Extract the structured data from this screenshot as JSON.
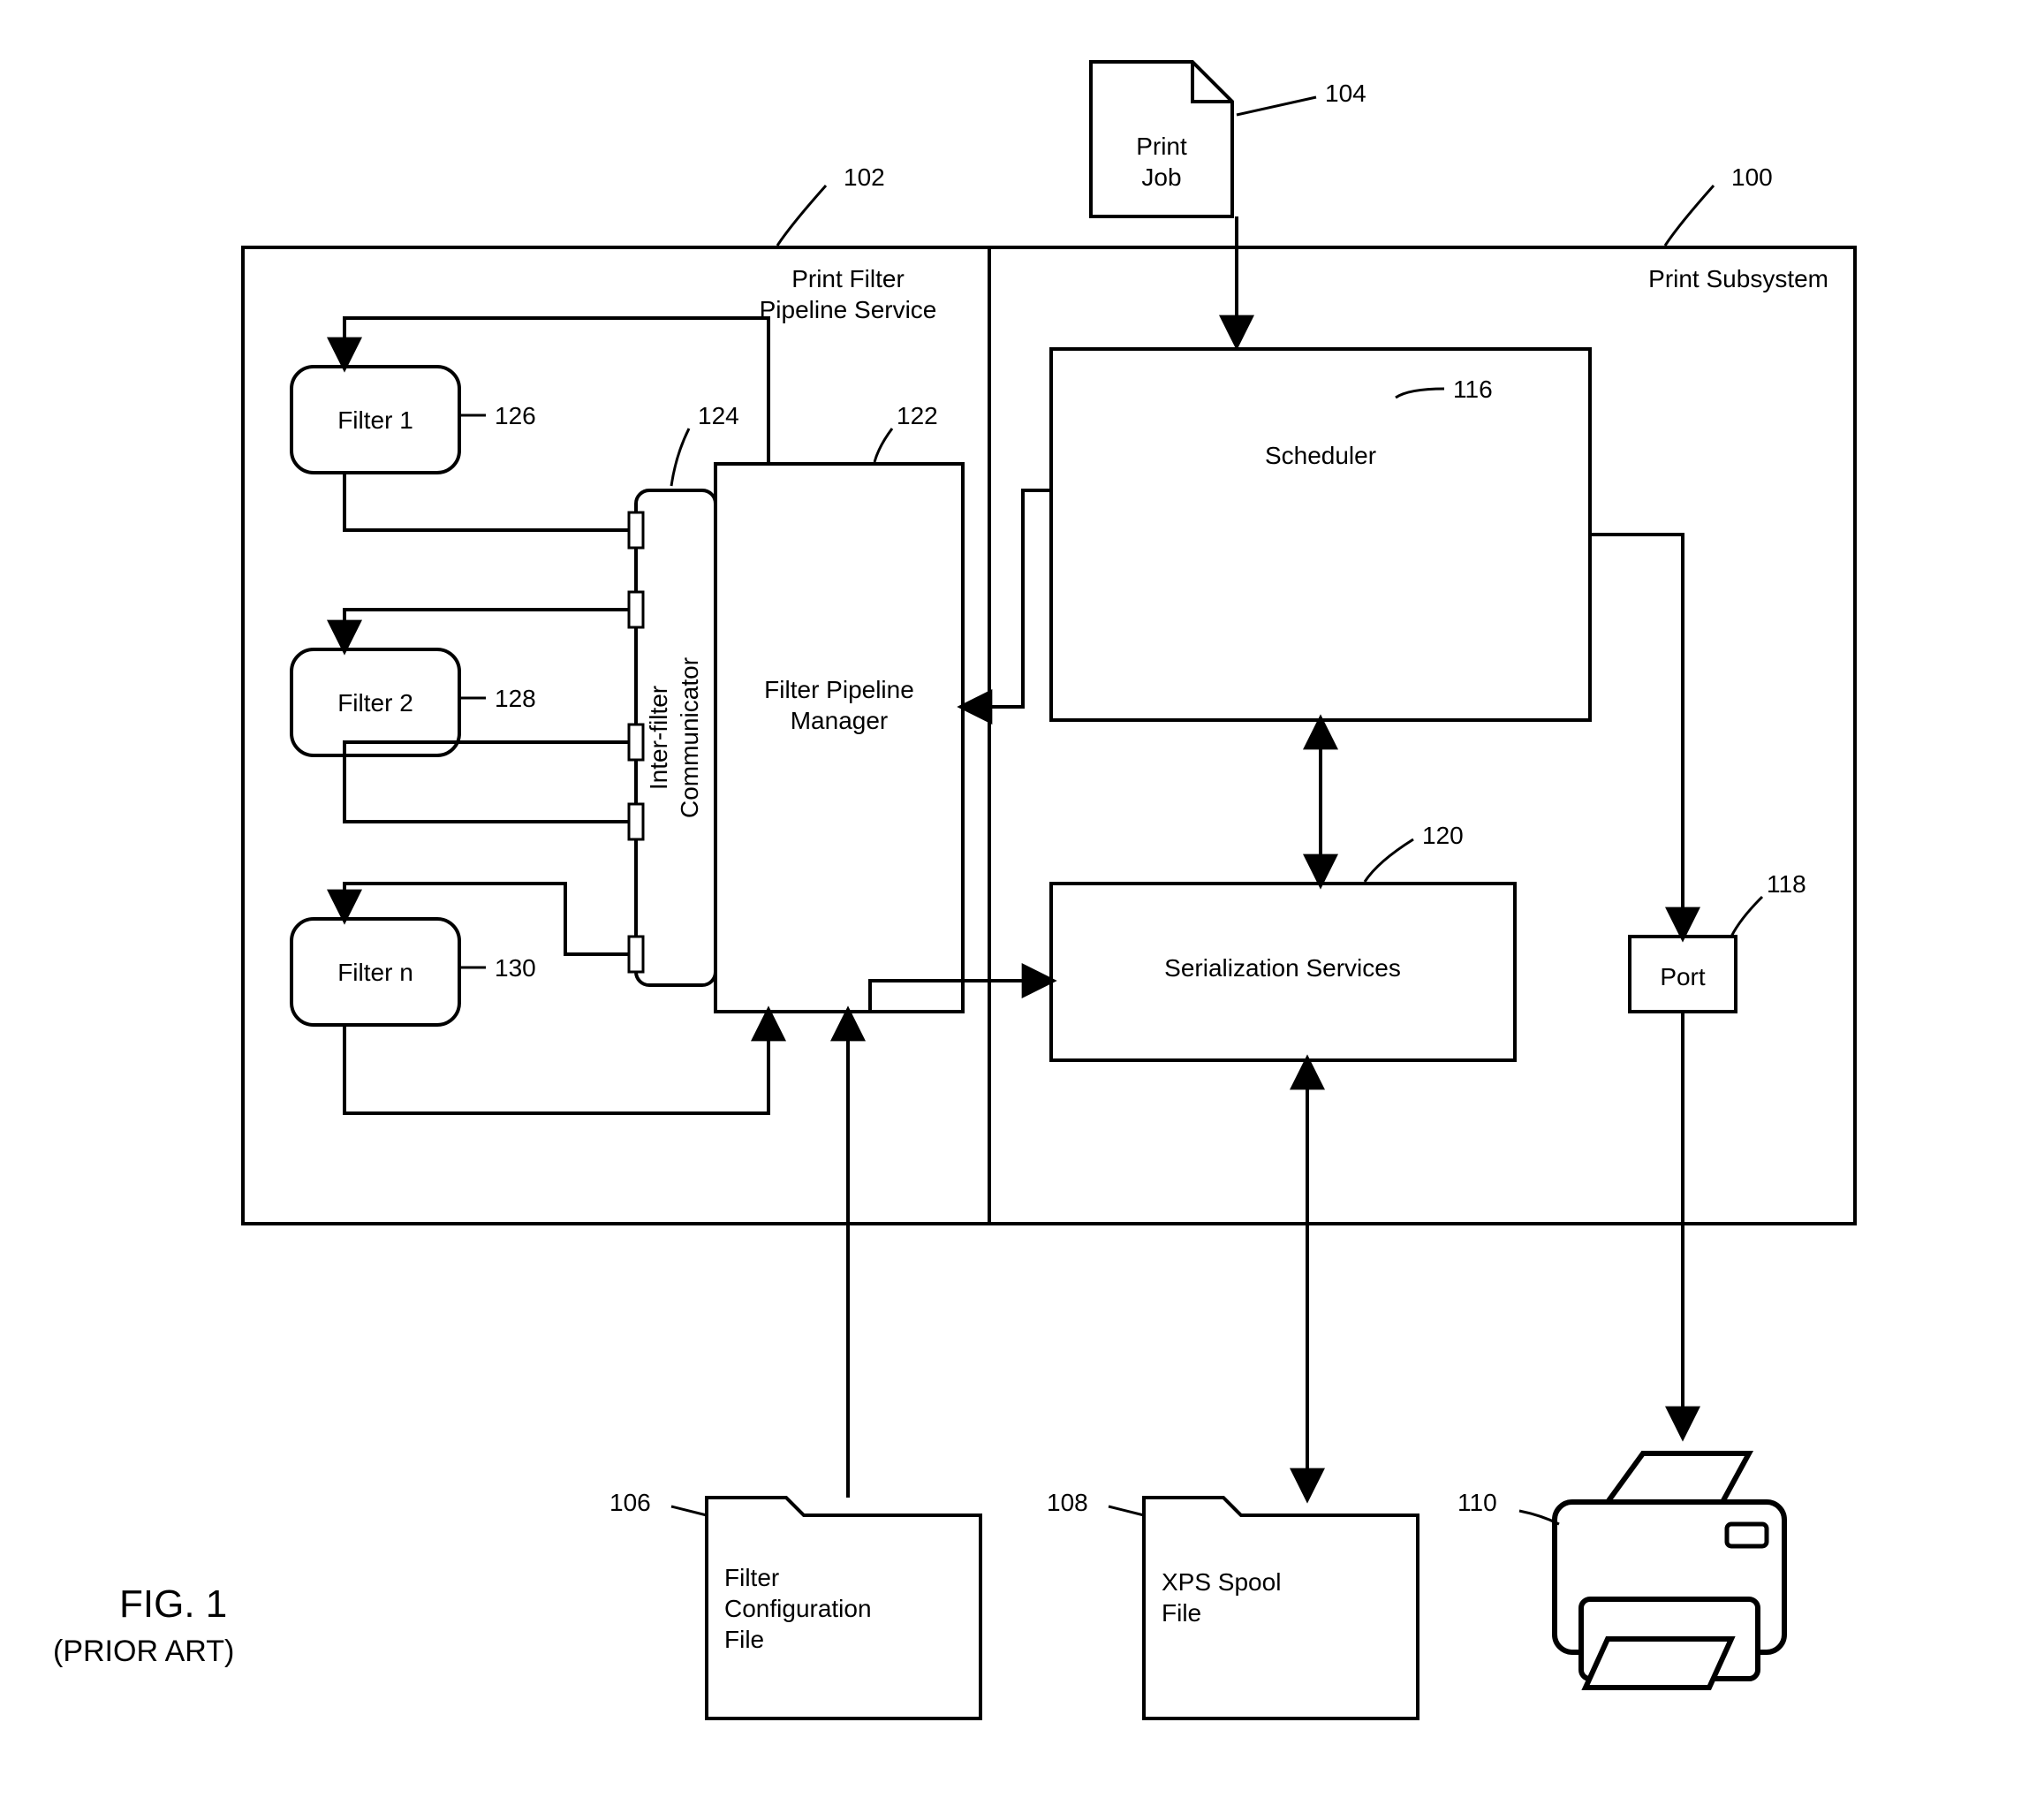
{
  "figure": {
    "title_line1": "FIG. 1",
    "title_line2": "(PRIOR ART)"
  },
  "refs": {
    "print_subsystem": "100",
    "pipeline_service": "102",
    "print_job": "104",
    "filter_config": "106",
    "xps_spool": "108",
    "printer": "110",
    "scheduler": "116",
    "port": "118",
    "serialization": "120",
    "filter_pipeline_manager": "122",
    "inter_filter_comm": "124",
    "filter1": "126",
    "filter2": "128",
    "filter_n": "130"
  },
  "labels": {
    "print_subsystem": "Print Subsystem",
    "pipeline_service_l1": "Print Filter",
    "pipeline_service_l2": "Pipeline Service",
    "print_job_l1": "Print",
    "print_job_l2": "Job",
    "scheduler": "Scheduler",
    "port": "Port",
    "serialization": "Serialization Services",
    "filter_pipeline_manager_l1": "Filter Pipeline",
    "filter_pipeline_manager_l2": "Manager",
    "inter_filter_comm_l1": "Inter-filter",
    "inter_filter_comm_l2": "Communicator",
    "filter1": "Filter 1",
    "filter2": "Filter 2",
    "filter_n": "Filter n",
    "filter_config_l1": "Filter",
    "filter_config_l2": "Configuration",
    "filter_config_l3": "File",
    "xps_spool_l1": "XPS Spool",
    "xps_spool_l2": "File"
  }
}
